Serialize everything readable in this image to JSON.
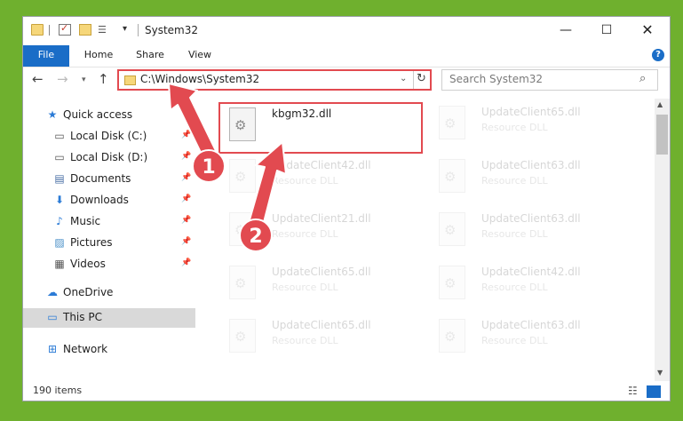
{
  "window": {
    "title": "System32",
    "controls": {
      "minimize": "—",
      "maximize": "☐",
      "close": "✕"
    }
  },
  "ribbon": {
    "tabs": [
      "File",
      "Home",
      "Share",
      "View"
    ],
    "help": "?"
  },
  "nav": {
    "address": "C:\\Windows\\System32",
    "search_placeholder": "Search System32"
  },
  "sidebar": {
    "items": [
      {
        "label": "Quick access",
        "icon": "star-icon",
        "glyph": "★",
        "color": "#2b7bd6"
      },
      {
        "label": "Local Disk (C:)",
        "icon": "drive-icon",
        "glyph": "▭",
        "color": "#555555",
        "pinned": true
      },
      {
        "label": "Local Disk (D:)",
        "icon": "drive-icon",
        "glyph": "▭",
        "color": "#555555",
        "pinned": true
      },
      {
        "label": "Documents",
        "icon": "documents-icon",
        "glyph": "▤",
        "color": "#4a6fa5",
        "pinned": true
      },
      {
        "label": "Downloads",
        "icon": "download-icon",
        "glyph": "⬇",
        "color": "#2b7bd6",
        "pinned": true
      },
      {
        "label": "Music",
        "icon": "music-icon",
        "glyph": "♪",
        "color": "#2b7bd6",
        "pinned": true
      },
      {
        "label": "Pictures",
        "icon": "pictures-icon",
        "glyph": "▨",
        "color": "#4a90c8",
        "pinned": true
      },
      {
        "label": "Videos",
        "icon": "videos-icon",
        "glyph": "▦",
        "color": "#555555",
        "pinned": true
      },
      {
        "label": "OneDrive",
        "icon": "cloud-icon",
        "glyph": "☁",
        "color": "#2b7bd6"
      },
      {
        "label": "This PC",
        "icon": "computer-icon",
        "glyph": "▭",
        "color": "#2b7bd6",
        "selected": true
      },
      {
        "label": "Network",
        "icon": "network-icon",
        "glyph": "⊞",
        "color": "#2b7bd6"
      }
    ]
  },
  "files": [
    {
      "name": "kbgm32.dll",
      "type": "",
      "highlighted": true
    },
    {
      "name": "UpdateClient65.dll",
      "type": "Resource DLL"
    },
    {
      "name": "UpdateClient42.dll",
      "type": "Resource DLL"
    },
    {
      "name": "UpdateClient63.dll",
      "type": "Resource DLL"
    },
    {
      "name": "UpdateClient21.dll",
      "type": "Resource DLL"
    },
    {
      "name": "UpdateClient63.dll",
      "type": "Resource DLL"
    },
    {
      "name": "UpdateClient65.dll",
      "type": "Resource DLL"
    },
    {
      "name": "UpdateClient42.dll",
      "type": "Resource DLL"
    },
    {
      "name": "UpdateClient65.dll",
      "type": "Resource DLL"
    },
    {
      "name": "UpdateClient63.dll",
      "type": "Resource DLL"
    }
  ],
  "status": {
    "count": "190 items"
  },
  "annotations": {
    "step1": "1",
    "step2": "2",
    "color": "#e24a50"
  },
  "colors": {
    "accent": "#1a6dc7",
    "background": "#6fb02e"
  }
}
